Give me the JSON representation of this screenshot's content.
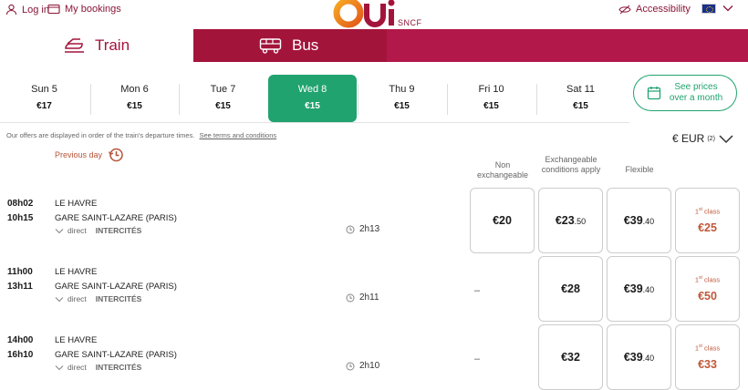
{
  "header": {
    "login": "Log in",
    "bookings": "My bookings",
    "logo_text": "Oui",
    "logo_sub": "SNCF",
    "accessibility": "Accessibility"
  },
  "tabs": {
    "train": "Train",
    "bus": "Bus"
  },
  "dates": [
    {
      "label": "Sun 5",
      "price": "€17"
    },
    {
      "label": "Mon 6",
      "price": "€15"
    },
    {
      "label": "Tue 7",
      "price": "€15"
    },
    {
      "label": "Wed 8",
      "price": "€15"
    },
    {
      "label": "Thu 9",
      "price": "€15"
    },
    {
      "label": "Fri 10",
      "price": "€15"
    },
    {
      "label": "Sat 11",
      "price": "€15"
    }
  ],
  "selected_date_index": 3,
  "month_button": "See prices over a month",
  "info": {
    "text": "Our offers are displayed in order of the train's departure times.",
    "link": "See terms and conditions"
  },
  "previous_day": "Previous day",
  "currency": {
    "label": "€ EUR",
    "note": "(2)"
  },
  "fare_headers": {
    "non_exchangeable": "Non exchangeable",
    "exchangeable": "Exchangeable conditions apply",
    "flexible": "Flexible"
  },
  "first_class_label": "1st class",
  "journeys": [
    {
      "depart": "08h02",
      "arrive": "10h15",
      "from": "LE HAVRE",
      "to": "GARE SAINT-LAZARE (PARIS)",
      "type": "direct",
      "train": "INTERCITÉS",
      "duration": "2h13",
      "non_exchangeable": {
        "main": "€20",
        "cents": ""
      },
      "exchangeable": {
        "main": "€23",
        "cents": ".50"
      },
      "flexible": {
        "main": "€39",
        "cents": ".40"
      },
      "first_class": "€25"
    },
    {
      "depart": "11h00",
      "arrive": "13h11",
      "from": "LE HAVRE",
      "to": "GARE SAINT-LAZARE (PARIS)",
      "type": "direct",
      "train": "INTERCITÉS",
      "duration": "2h11",
      "non_exchangeable": null,
      "non_exchangeable_dash": "–",
      "exchangeable": {
        "main": "€28",
        "cents": ""
      },
      "flexible": {
        "main": "€39",
        "cents": ".40"
      },
      "first_class": "€50"
    },
    {
      "depart": "14h00",
      "arrive": "16h10",
      "from": "LE HAVRE",
      "to": "GARE SAINT-LAZARE (PARIS)",
      "type": "direct",
      "train": "INTERCITÉS",
      "duration": "2h10",
      "non_exchangeable": null,
      "non_exchangeable_dash": "–",
      "exchangeable": {
        "main": "€32",
        "cents": ""
      },
      "flexible": {
        "main": "€39",
        "cents": ".40"
      },
      "first_class": "€33"
    }
  ],
  "colors": {
    "brand": "#a3143b",
    "accent_green": "#21a36f",
    "first_class": "#c0583a"
  }
}
